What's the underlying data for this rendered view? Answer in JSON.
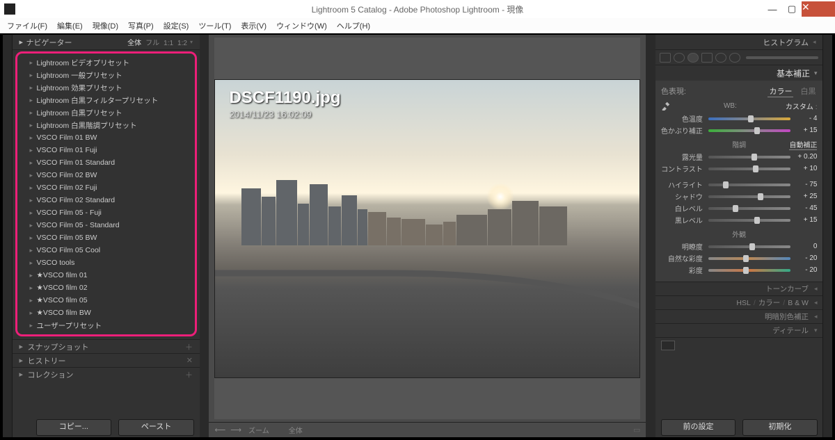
{
  "titlebar": {
    "title": "Lightroom 5 Catalog - Adobe Photoshop Lightroom - 現像"
  },
  "menubar": [
    "ファイル(F)",
    "編集(E)",
    "現像(D)",
    "写真(P)",
    "設定(S)",
    "ツール(T)",
    "表示(V)",
    "ウィンドウ(W)",
    "ヘルプ(H)"
  ],
  "left": {
    "navigator": "ナビゲーター",
    "nav_modes": [
      "全体",
      "フル",
      "1:1",
      "1:2"
    ],
    "nav_active": "全体",
    "presets": [
      "Lightroom ビデオプリセット",
      "Lightroom 一般プリセット",
      "Lightroom 効果プリセット",
      "Lightroom 白黒フィルタープリセット",
      "Lightroom 白黒プリセット",
      "Lightroom 白黒階調プリセット",
      "VSCO Film 01 BW",
      "VSCO Film 01 Fuji",
      "VSCO Film 01 Standard",
      "VSCO Film 02 BW",
      "VSCO Film 02 Fuji",
      "VSCO Film 02 Standard",
      "VSCO Film 05 - Fuji",
      "VSCO Film 05 - Standard",
      "VSCO Film 05 BW",
      "VSCO Film 05 Cool",
      "VSCO tools",
      "★VSCO film 01",
      "★VSCO film 02",
      "★VSCO film 05",
      "★VSCO film BW",
      "ユーザープリセット"
    ],
    "panels": {
      "snapshot": "スナップショット",
      "history": "ヒストリー",
      "collection": "コレクション"
    },
    "buttons": {
      "copy": "コピー...",
      "paste": "ペースト"
    }
  },
  "center": {
    "filename": "DSCF1190.jpg",
    "timestamp": "2014/11/23 16:02:09",
    "zoom_label": "ズーム",
    "zoom_full": "全体"
  },
  "right": {
    "histogram": "ヒストグラム",
    "basic": "基本補正",
    "treatment": {
      "label": "色表現:",
      "color": "カラー",
      "bw": "白黒"
    },
    "wb": {
      "label": "WB:",
      "value": "カスタム"
    },
    "temp": {
      "label": "色温度",
      "value": "- 4",
      "pos": 48
    },
    "tint": {
      "label": "色かぶり補正",
      "value": "+ 15",
      "pos": 56
    },
    "tone_title": "階調",
    "auto": "自動補正",
    "exposure": {
      "label": "露光量",
      "value": "+ 0.20",
      "pos": 52
    },
    "contrast": {
      "label": "コントラスト",
      "value": "+ 10",
      "pos": 54
    },
    "highlights": {
      "label": "ハイライト",
      "value": "- 75",
      "pos": 18
    },
    "shadows": {
      "label": "シャドウ",
      "value": "+ 25",
      "pos": 60
    },
    "whites": {
      "label": "白レベル",
      "value": "- 45",
      "pos": 30
    },
    "blacks": {
      "label": "黒レベル",
      "value": "+ 15",
      "pos": 56
    },
    "presence_title": "外観",
    "clarity": {
      "label": "明瞭度",
      "value": "0",
      "pos": 50
    },
    "vibrance": {
      "label": "自然な彩度",
      "value": "- 20",
      "pos": 42
    },
    "saturation": {
      "label": "彩度",
      "value": "- 20",
      "pos": 42
    },
    "collapsed": {
      "tonecurve": "トーンカーブ",
      "hsl": "HSL",
      "hsl_sep": "/",
      "color": "カラー",
      "bw": "B & W",
      "splittone": "明暗別色補正",
      "detail": "ディテール"
    },
    "buttons": {
      "prev": "前の設定",
      "reset": "初期化"
    }
  }
}
